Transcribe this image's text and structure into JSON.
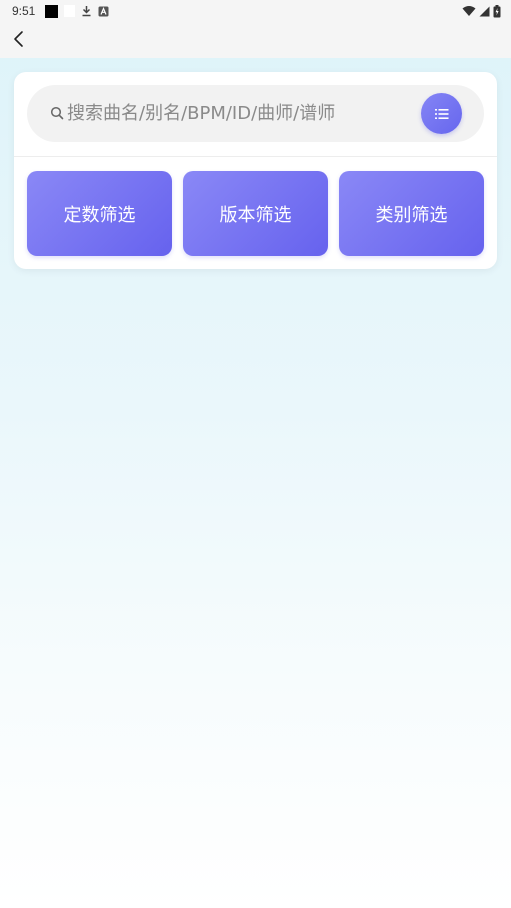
{
  "status_bar": {
    "time": "9:51",
    "icons": [
      "black-square-icon",
      "white-square-icon",
      "download-icon",
      "a-icon",
      "wifi-icon",
      "signal-icon",
      "battery-charging-icon"
    ]
  },
  "app_bar": {
    "back_icon": "chevron-left-icon"
  },
  "search": {
    "placeholder": "搜索曲名/别名/BPM/ID/曲师/谱师",
    "value": ""
  },
  "filters": [
    {
      "label": "定数筛选"
    },
    {
      "label": "版本筛选"
    },
    {
      "label": "类别筛选"
    }
  ],
  "colors": {
    "accent": "#6e6cf0",
    "background_top": "#ddf3f9",
    "background_bottom": "#ffffff"
  }
}
